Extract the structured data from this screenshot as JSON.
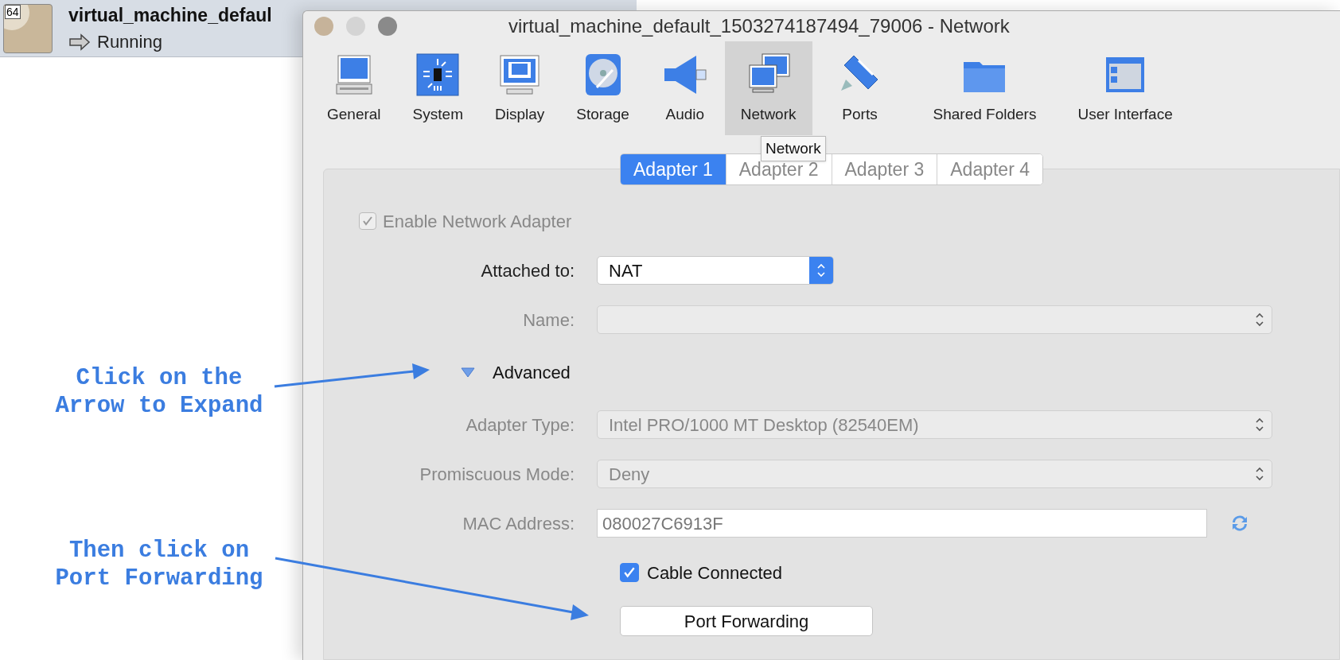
{
  "vm": {
    "badge": "64",
    "name": "virtual_machine_defaul",
    "state": "Running"
  },
  "window": {
    "title": "virtual_machine_default_1503274187494_79006 - Network"
  },
  "toolbar": [
    {
      "label": "General",
      "selected": false
    },
    {
      "label": "System",
      "selected": false
    },
    {
      "label": "Display",
      "selected": false
    },
    {
      "label": "Storage",
      "selected": false
    },
    {
      "label": "Audio",
      "selected": false
    },
    {
      "label": "Network",
      "selected": true
    },
    {
      "label": "Ports",
      "selected": false
    },
    {
      "label": "Shared Folders",
      "selected": false
    },
    {
      "label": "User Interface",
      "selected": false
    }
  ],
  "tooltip": "Network",
  "tabs": [
    {
      "label": "Adapter 1",
      "selected": true
    },
    {
      "label": "Adapter 2",
      "selected": false
    },
    {
      "label": "Adapter 3",
      "selected": false
    },
    {
      "label": "Adapter 4",
      "selected": false
    }
  ],
  "form": {
    "enable_adapter": {
      "label": "Enable Network Adapter",
      "checked": true,
      "disabled": true
    },
    "attached_to": {
      "label": "Attached to:",
      "value": "NAT"
    },
    "name": {
      "label": "Name:",
      "disabled": true
    },
    "advanced": {
      "label": "Advanced",
      "expanded": true
    },
    "adapter_type": {
      "label": "Adapter Type:",
      "value": "Intel PRO/1000 MT Desktop (82540EM)"
    },
    "promiscuous_mode": {
      "label": "Promiscuous Mode:",
      "value": "Deny"
    },
    "mac_address": {
      "label": "MAC Address:",
      "value": "080027C6913F"
    },
    "cable_connected": {
      "label": "Cable Connected",
      "checked": true
    },
    "port_forwarding": {
      "label": "Port Forwarding"
    }
  },
  "annotations": [
    {
      "text": "Click on the Arrow to Expand"
    },
    {
      "text": "Then click on Port Forwarding"
    }
  ]
}
